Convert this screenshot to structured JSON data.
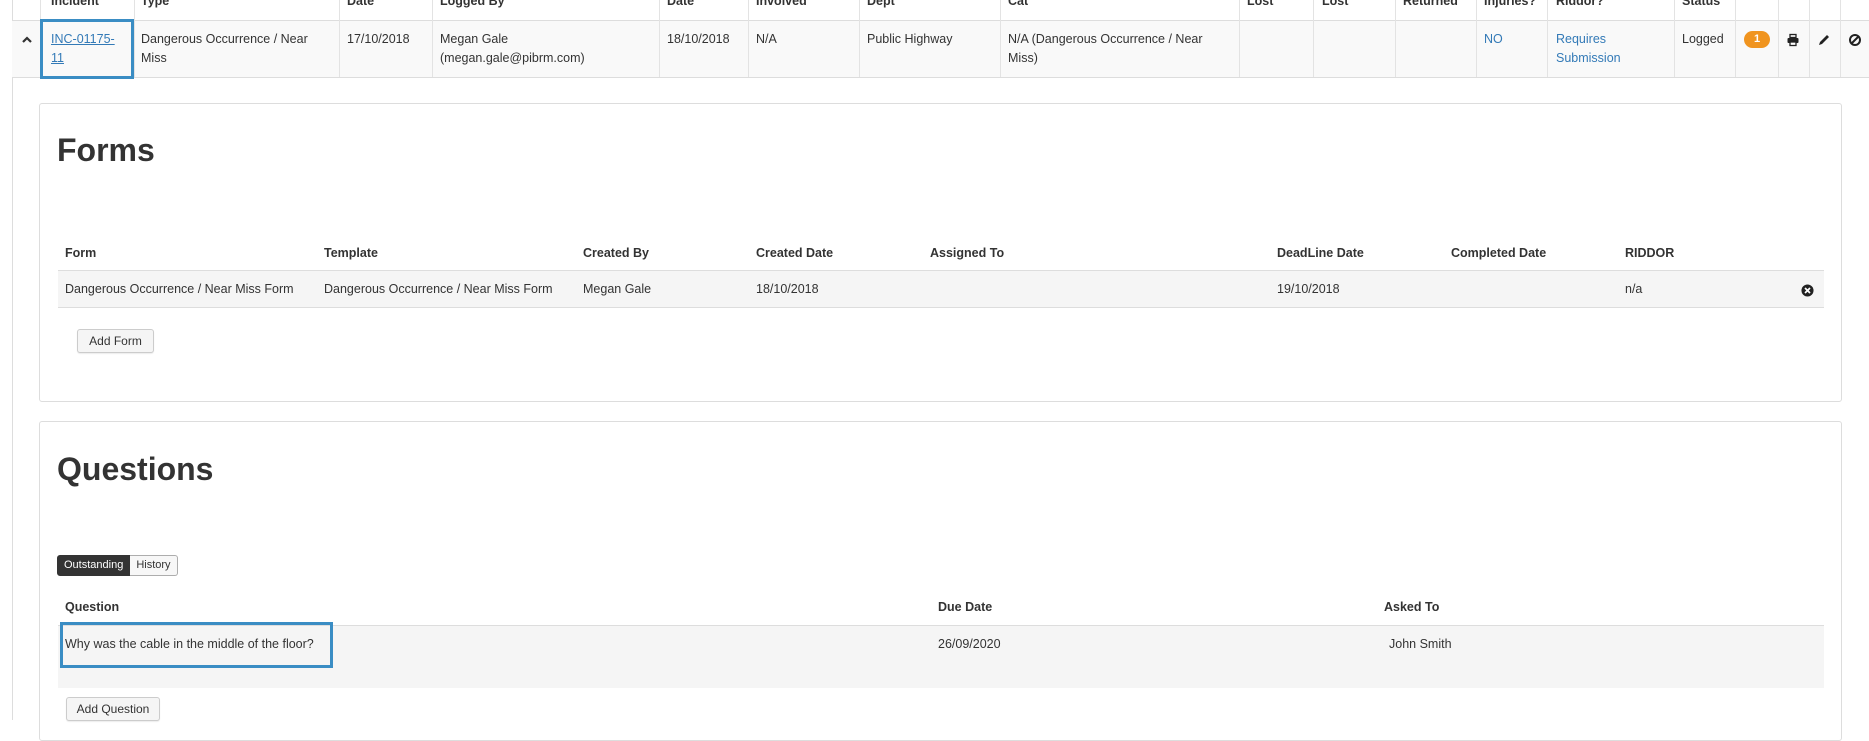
{
  "incidents_table": {
    "headers": [
      "Incident",
      "Type",
      "Date",
      "Logged By",
      "Date",
      "Involved",
      "Dept",
      "Cat",
      "Lost",
      "Lost",
      "Returned",
      "Injuries?",
      "Riddor?",
      "Status"
    ],
    "row": {
      "incident_ref": "INC-01175-11",
      "incident_ref_line1": "INC-01175-",
      "incident_ref_line2": "11",
      "type_line1": "Dangerous Occurrence / Near",
      "type_line2": "Miss",
      "date": "17/10/2018",
      "logged_by_line1": "Megan Gale",
      "logged_by_line2": "(megan.gale@pibrm.com)",
      "date2": "18/10/2018",
      "involved": "N/A",
      "dept": "Public Highway",
      "cat_line1": "N/A (Dangerous Occurrence / Near",
      "cat_line2": "Miss)",
      "injuries": "NO",
      "riddor_line1": "Requires",
      "riddor_line2": "Submission",
      "status": "Logged",
      "badge_count": "1",
      "badge_color": "#f0941f"
    }
  },
  "forms": {
    "title": "Forms",
    "headers": [
      "Form",
      "Template",
      "Created By",
      "Created Date",
      "Assigned To",
      "DeadLine Date",
      "Completed Date",
      "RIDDOR"
    ],
    "rows": [
      {
        "form": "Dangerous Occurrence / Near Miss Form",
        "template": "Dangerous Occurrence / Near Miss Form",
        "created_by": "Megan Gale",
        "created_date": "18/10/2018",
        "assigned_to": "",
        "deadline_date": "19/10/2018",
        "completed_date": "",
        "riddor": "n/a"
      }
    ],
    "add_button": "Add Form"
  },
  "questions": {
    "title": "Questions",
    "tabs": [
      "Outstanding",
      "History"
    ],
    "headers": [
      "Question",
      "Due Date",
      "Asked To"
    ],
    "rows": [
      {
        "question": "Why was the cable in the middle of the floor?",
        "due_date": "26/09/2020",
        "asked_to": "John Smith"
      }
    ],
    "add_button": "Add Question"
  },
  "colors": {
    "link": "#337ab7",
    "highlight": "#3a8dc4",
    "badge": "#f0941f"
  }
}
